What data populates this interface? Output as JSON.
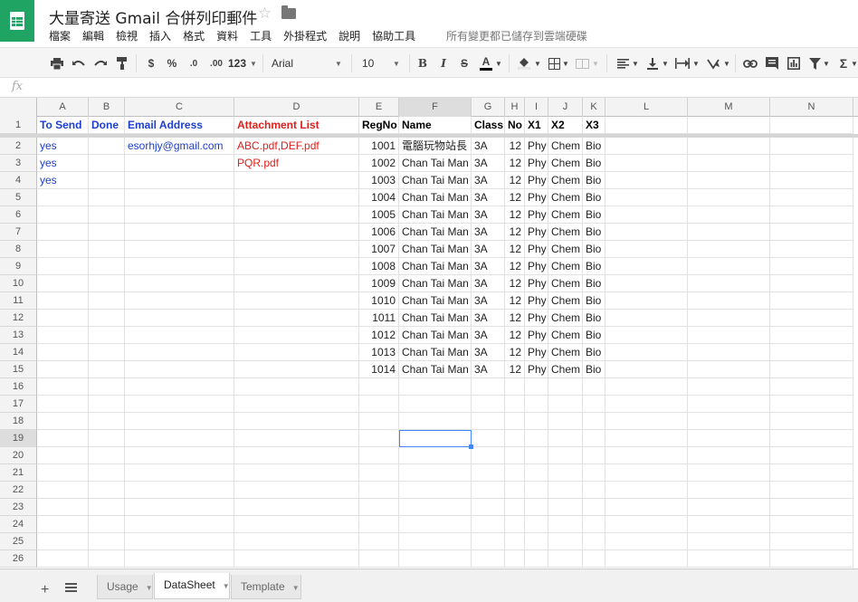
{
  "document": {
    "title": "大量寄送 Gmail 合併列印郵件",
    "save_status": "所有變更都已儲存到雲端硬碟"
  },
  "menu": [
    "檔案",
    "編輯",
    "檢視",
    "插入",
    "格式",
    "資料",
    "工具",
    "外掛程式",
    "說明",
    "協助工具"
  ],
  "toolbar": {
    "currency": "$",
    "percent": "%",
    "decrease_decimal": ".0",
    "increase_decimal": ".00",
    "more_formats": "123",
    "font": "Arial",
    "font_size": "10",
    "bold": "B",
    "italic": "I",
    "strikethrough": "S",
    "text_color": "A",
    "function": "Σ"
  },
  "formula_bar": {
    "fx_label": "fx"
  },
  "colors": {
    "header_blue": "#1a3fd0",
    "header_red": "#e0201a",
    "data_blue": "#1a3fd0",
    "data_red": "#e0201a",
    "sheets_green": "#1fa463",
    "selection": "#4285f4"
  },
  "grid": {
    "columns": [
      "A",
      "B",
      "C",
      "D",
      "E",
      "F",
      "G",
      "H",
      "I",
      "J",
      "K",
      "L",
      "M",
      "N"
    ],
    "row_numbers": [
      "1",
      "2",
      "3",
      "4",
      "5",
      "6",
      "7",
      "8",
      "9",
      "10",
      "11",
      "12",
      "13",
      "14",
      "15",
      "16",
      "17",
      "18",
      "19",
      "20",
      "21",
      "22",
      "23",
      "24",
      "25",
      "26"
    ],
    "selected_cell": "F19",
    "headers": {
      "A": "To Send",
      "B": "Done",
      "C": "Email Address",
      "D": "Attachment List",
      "E": "RegNo",
      "F": "Name",
      "G": "Class",
      "H": "No",
      "I": "X1",
      "J": "X2",
      "K": "X3"
    },
    "rows": [
      {
        "A": "yes",
        "B": "",
        "C": "esorhjy@gmail.com",
        "D": "ABC.pdf,DEF.pdf",
        "E": "1001",
        "F": "電腦玩物站長",
        "G": "3A",
        "H": "12",
        "I": "Phy",
        "J": "Chem",
        "K": "Bio"
      },
      {
        "A": "yes",
        "B": "",
        "C": "",
        "D": "PQR.pdf",
        "E": "1002",
        "F": "Chan Tai Man",
        "G": "3A",
        "H": "12",
        "I": "Phy",
        "J": "Chem",
        "K": "Bio"
      },
      {
        "A": "yes",
        "B": "",
        "C": "",
        "D": "",
        "E": "1003",
        "F": "Chan Tai Man",
        "G": "3A",
        "H": "12",
        "I": "Phy",
        "J": "Chem",
        "K": "Bio"
      },
      {
        "A": "",
        "B": "",
        "C": "",
        "D": "",
        "E": "1004",
        "F": "Chan Tai Man",
        "G": "3A",
        "H": "12",
        "I": "Phy",
        "J": "Chem",
        "K": "Bio"
      },
      {
        "A": "",
        "B": "",
        "C": "",
        "D": "",
        "E": "1005",
        "F": "Chan Tai Man",
        "G": "3A",
        "H": "12",
        "I": "Phy",
        "J": "Chem",
        "K": "Bio"
      },
      {
        "A": "",
        "B": "",
        "C": "",
        "D": "",
        "E": "1006",
        "F": "Chan Tai Man",
        "G": "3A",
        "H": "12",
        "I": "Phy",
        "J": "Chem",
        "K": "Bio"
      },
      {
        "A": "",
        "B": "",
        "C": "",
        "D": "",
        "E": "1007",
        "F": "Chan Tai Man",
        "G": "3A",
        "H": "12",
        "I": "Phy",
        "J": "Chem",
        "K": "Bio"
      },
      {
        "A": "",
        "B": "",
        "C": "",
        "D": "",
        "E": "1008",
        "F": "Chan Tai Man",
        "G": "3A",
        "H": "12",
        "I": "Phy",
        "J": "Chem",
        "K": "Bio"
      },
      {
        "A": "",
        "B": "",
        "C": "",
        "D": "",
        "E": "1009",
        "F": "Chan Tai Man",
        "G": "3A",
        "H": "12",
        "I": "Phy",
        "J": "Chem",
        "K": "Bio"
      },
      {
        "A": "",
        "B": "",
        "C": "",
        "D": "",
        "E": "1010",
        "F": "Chan Tai Man",
        "G": "3A",
        "H": "12",
        "I": "Phy",
        "J": "Chem",
        "K": "Bio"
      },
      {
        "A": "",
        "B": "",
        "C": "",
        "D": "",
        "E": "1011",
        "F": "Chan Tai Man",
        "G": "3A",
        "H": "12",
        "I": "Phy",
        "J": "Chem",
        "K": "Bio"
      },
      {
        "A": "",
        "B": "",
        "C": "",
        "D": "",
        "E": "1012",
        "F": "Chan Tai Man",
        "G": "3A",
        "H": "12",
        "I": "Phy",
        "J": "Chem",
        "K": "Bio"
      },
      {
        "A": "",
        "B": "",
        "C": "",
        "D": "",
        "E": "1013",
        "F": "Chan Tai Man",
        "G": "3A",
        "H": "12",
        "I": "Phy",
        "J": "Chem",
        "K": "Bio"
      },
      {
        "A": "",
        "B": "",
        "C": "",
        "D": "",
        "E": "1014",
        "F": "Chan Tai Man",
        "G": "3A",
        "H": "12",
        "I": "Phy",
        "J": "Chem",
        "K": "Bio"
      }
    ]
  },
  "sheet_tabs": [
    {
      "label": "Usage",
      "active": false
    },
    {
      "label": "DataSheet",
      "active": true
    },
    {
      "label": "Template",
      "active": false
    }
  ]
}
